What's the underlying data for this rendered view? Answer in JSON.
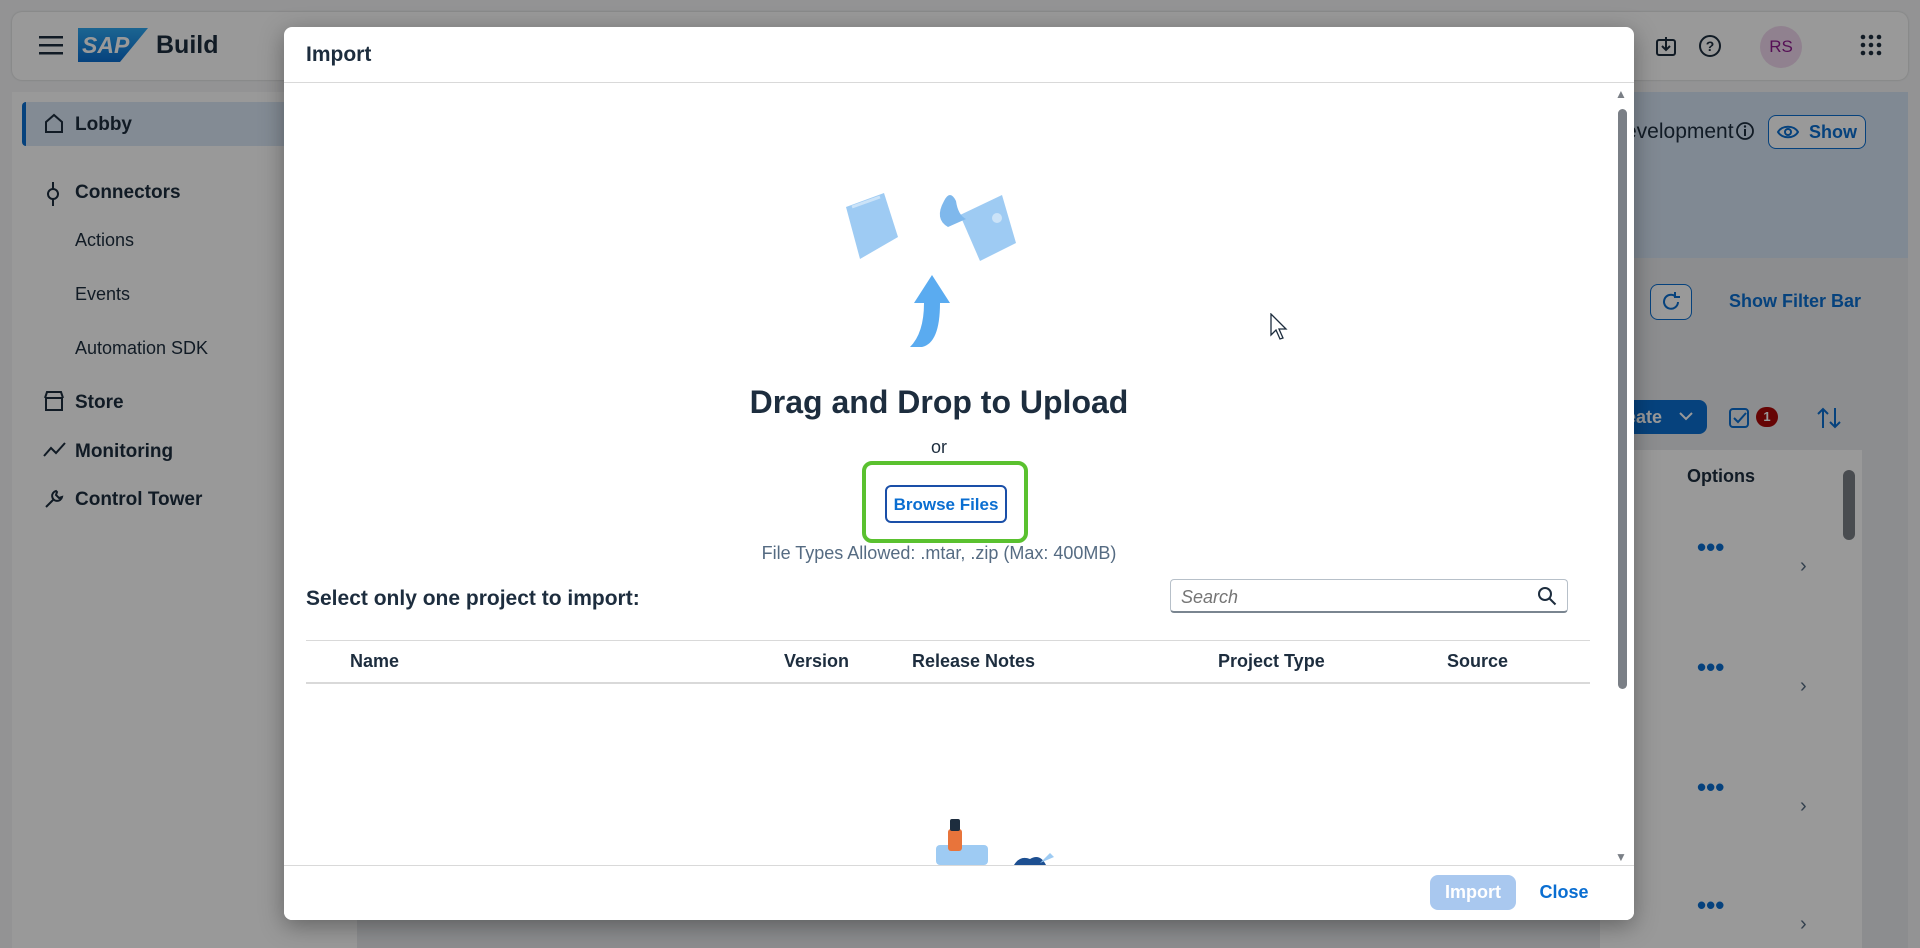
{
  "shell": {
    "brand_logo": "SAP",
    "brand_name": "Build",
    "avatar": "RS",
    "notification_count": "1"
  },
  "sidebar": {
    "items": [
      {
        "label": "Lobby",
        "icon": "home-icon"
      },
      {
        "label": "Connectors",
        "icon": "connector-icon"
      },
      {
        "label": "Actions"
      },
      {
        "label": "Events"
      },
      {
        "label": "Automation SDK"
      },
      {
        "label": "Store",
        "icon": "store-icon"
      },
      {
        "label": "Monitoring",
        "icon": "monitoring-icon"
      },
      {
        "label": "Control Tower",
        "icon": "wrench-icon"
      }
    ]
  },
  "background": {
    "banner_text": "evelopment",
    "show_button": "Show",
    "show_filter_bar": "Show Filter Bar",
    "create_button": "eate",
    "options_header": "Options"
  },
  "dialog": {
    "title": "Import",
    "drop_title": "Drag and Drop to Upload",
    "or": "or",
    "browse_button": "Browse Files",
    "file_types": "File Types Allowed: .mtar, .zip  (Max: 400MB)",
    "select_label": "Select only one project to import:",
    "search_placeholder": "Search",
    "table_headers": [
      "Name",
      "Version",
      "Release Notes",
      "Project Type",
      "Source"
    ],
    "import_button": "Import",
    "close_button": "Close"
  },
  "colors": {
    "accent": "#0a6ed1",
    "highlight": "#5ac12f",
    "badge": "#aa0808"
  }
}
